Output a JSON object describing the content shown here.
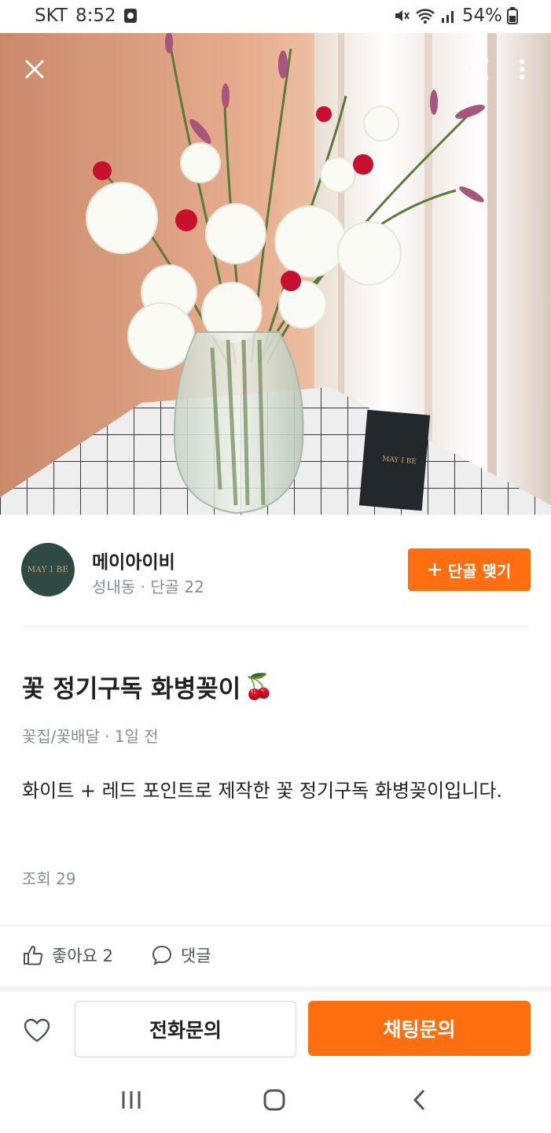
{
  "status": {
    "carrier": "SKT",
    "time": "8:52",
    "battery": "54%"
  },
  "hero": {
    "card_text": "MAY I BE"
  },
  "seller": {
    "avatar_text": "MAY I BE",
    "name": "메이아이비",
    "meta": "성내동 · 단골 22",
    "regular_button": "단골 맺기"
  },
  "post": {
    "title": "꽃 정기구독 화병꽂이",
    "title_emoji": "🍒",
    "meta": "꽃집/꽃배달 · 1일 전",
    "description": "화이트 + 레드 포인트로 제작한 꽃 정기구독 화병꽂이입니다.",
    "views": "조회 29"
  },
  "actions": {
    "like_label": "좋아요 2",
    "comment_label": "댓글"
  },
  "bottom": {
    "call_button": "전화문의",
    "chat_button": "채팅문의"
  },
  "icons": [
    "close-icon",
    "share-icon",
    "more-icon",
    "plus-icon",
    "thumbs-up-icon",
    "comment-icon",
    "heart-icon",
    "recents-icon",
    "home-icon",
    "back-icon"
  ],
  "colors": {
    "accent": "#ff6f0f",
    "avatar_bg": "#2f4a43"
  }
}
